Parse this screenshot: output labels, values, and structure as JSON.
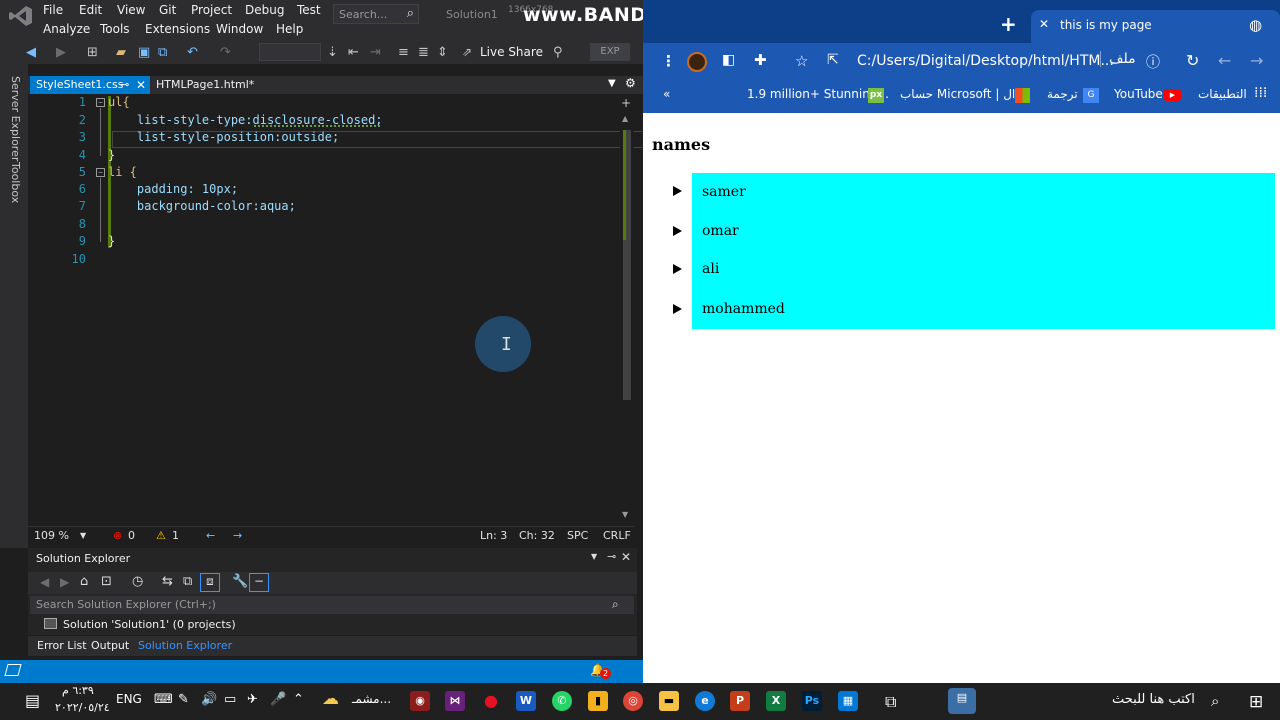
{
  "vs": {
    "menu": [
      "File",
      "Edit",
      "View",
      "Git",
      "Project",
      "Debug",
      "Test",
      "Analyze",
      "Tools",
      "Extensions",
      "Window",
      "Help"
    ],
    "search_placeholder": "Search...",
    "solution_name": "Solution1",
    "resolution": "1366x768",
    "recorder_watermark": "www.BANDICAM.com",
    "live_share": "Live Share",
    "exp_label": "EXP",
    "side_tabs": [
      "Server Explorer",
      "Toolbox"
    ],
    "tabs": [
      {
        "label": "StyleSheet1.css",
        "active": true
      },
      {
        "label": "HTMLPage1.html*",
        "active": false
      }
    ],
    "code_lines": [
      "ul{",
      "    list-style-type:disclosure-closed;",
      "    list-style-position:outside;",
      "}",
      "li {",
      "    padding: 10px;",
      "    background-color:aqua;",
      "",
      "}",
      ""
    ],
    "line_numbers": [
      "1",
      "2",
      "3",
      "4",
      "5",
      "6",
      "7",
      "8",
      "9",
      "10"
    ],
    "status": {
      "zoom": "109 %",
      "errors": "0",
      "warnings": "1",
      "ln": "Ln: 3",
      "ch": "Ch: 32",
      "spc": "SPC",
      "crlf": "CRLF"
    },
    "solution_explorer": {
      "title": "Solution Explorer",
      "search_placeholder": "Search Solution Explorer (Ctrl+;)",
      "node": "Solution 'Solution1' (0 projects)"
    },
    "bottom_tabs": [
      "Error List",
      "Output",
      "Solution Explorer"
    ],
    "notification_count": "2"
  },
  "chrome": {
    "tab_title": "this is my page",
    "address": "C:/Users/Digital/Desktop/html/HTM...",
    "address_label": "ملف",
    "bookmarks": [
      "التطبيقات",
      "YouTube",
      "ترجمة",
      "حساب Microsoft | ال...",
      "1.9 million+ Stunning..."
    ],
    "page": {
      "heading": "names",
      "items": [
        "samer",
        "omar",
        "ali",
        "mohammed"
      ]
    }
  },
  "taskbar": {
    "search_text": "اكتب هنا للبحث",
    "weather_text": "مشمـ...",
    "language": "ENG",
    "time": "٦:٣٩ م",
    "date": "٢٠٢٢/٠٥/٢٤"
  },
  "colors": {
    "vs_accent": "#007acc",
    "chrome_blue": "#1d58b3",
    "list_bg": "#00ffff"
  }
}
